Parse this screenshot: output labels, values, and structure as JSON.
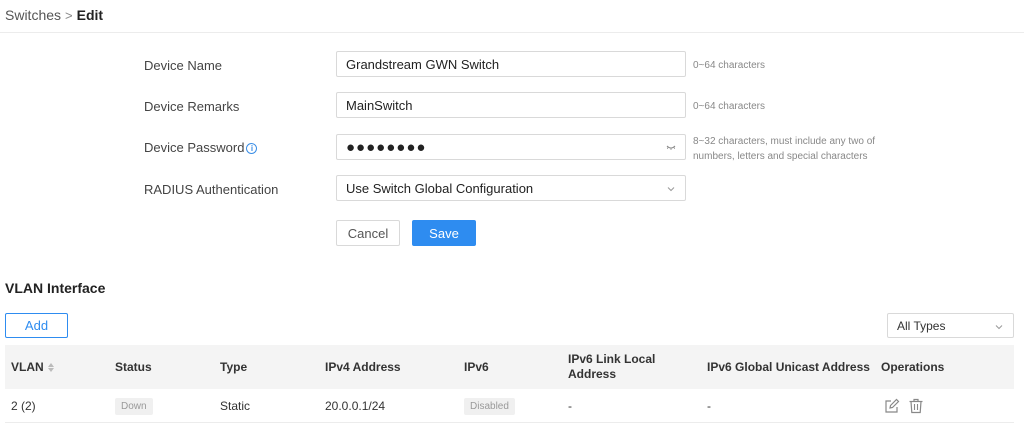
{
  "breadcrumb": {
    "parent": "Switches",
    "separator": ">",
    "current": "Edit"
  },
  "form": {
    "device_name": {
      "label": "Device Name",
      "value": "Grandstream GWN Switch",
      "hint": "0~64 characters"
    },
    "device_remarks": {
      "label": "Device Remarks",
      "value": "MainSwitch",
      "hint": "0~64 characters"
    },
    "device_password": {
      "label": "Device Password",
      "value": "●●●●●●●●",
      "hint_line1": "8~32 characters, must include any two of",
      "hint_line2": "numbers, letters and special characters"
    },
    "radius": {
      "label": "RADIUS Authentication",
      "value": "Use Switch Global Configuration"
    },
    "cancel_label": "Cancel",
    "save_label": "Save"
  },
  "vlan": {
    "title": "VLAN Interface",
    "add_label": "Add",
    "type_filter": "All Types",
    "columns": [
      "VLAN",
      "Status",
      "Type",
      "IPv4 Address",
      "IPv6",
      "IPv6 Link Local Address",
      "IPv6 Global Unicast Address",
      "Operations"
    ],
    "rows": [
      {
        "vlan": "2 (2)",
        "status": "Down",
        "type": "Static",
        "ipv4": "20.0.0.1/24",
        "ipv6": "Disabled",
        "link_local": "-",
        "global_unicast": "-"
      }
    ]
  },
  "icons": {
    "info": "info-circle-icon",
    "eye": "eye-closed-icon",
    "chevron": "chevron-down-icon",
    "sort": "sort-icon",
    "edit": "edit-icon",
    "delete": "trash-icon"
  },
  "colors": {
    "primary": "#2e8cf0",
    "header_bg": "#f4f4f4"
  }
}
